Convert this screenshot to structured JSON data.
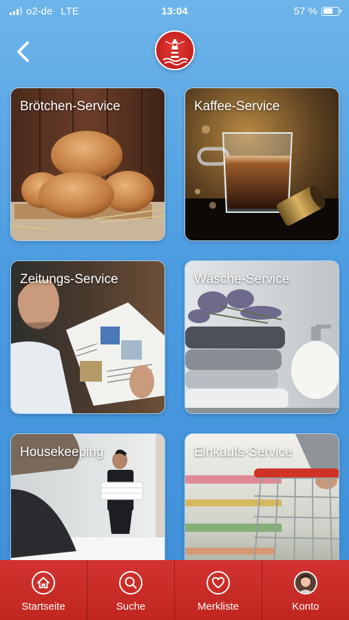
{
  "status_bar": {
    "carrier": "o2-de",
    "network": "LTE",
    "time": "13:04",
    "battery": "57 %",
    "battery_level": 0.57
  },
  "header": {
    "back_icon": "chevron-left-icon",
    "logo": "lighthouse-logo"
  },
  "tiles": [
    {
      "label": "Brötchen-Service",
      "image": "bread-rolls"
    },
    {
      "label": "Kaffee-Service",
      "image": "espresso-cup"
    },
    {
      "label": "Zeitungs-Service",
      "image": "man-reading-newspaper"
    },
    {
      "label": "Wäsche-Service",
      "image": "folded-towels"
    },
    {
      "label": "Housekeeping",
      "image": "housekeeper-with-towels"
    },
    {
      "label": "Einkaufs-Service",
      "image": "shopping-cart"
    }
  ],
  "tab_bar": {
    "items": [
      {
        "label": "Startseite",
        "icon": "home-icon"
      },
      {
        "label": "Suche",
        "icon": "search-icon"
      },
      {
        "label": "Merkliste",
        "icon": "heart-icon"
      },
      {
        "label": "Konto",
        "icon": "avatar"
      }
    ]
  },
  "colors": {
    "background": "#4a9be0",
    "tab_bar": "#c8291f",
    "logo": "#c5201e"
  }
}
